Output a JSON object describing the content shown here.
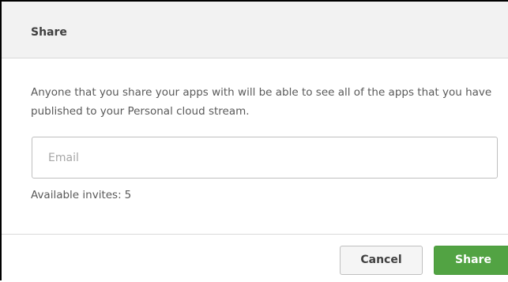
{
  "dialog": {
    "title": "Share",
    "description": "Anyone that you share your apps with will be able to see all of the apps that you have published to your Personal cloud stream.",
    "email": {
      "value": "",
      "placeholder": "Email"
    },
    "invites": {
      "label": "Available invites:",
      "count": "5"
    },
    "buttons": {
      "cancel_label": "Cancel",
      "share_label": "Share"
    },
    "colors": {
      "share_button": "#52a343",
      "header_background": "#f2f2f2"
    }
  }
}
